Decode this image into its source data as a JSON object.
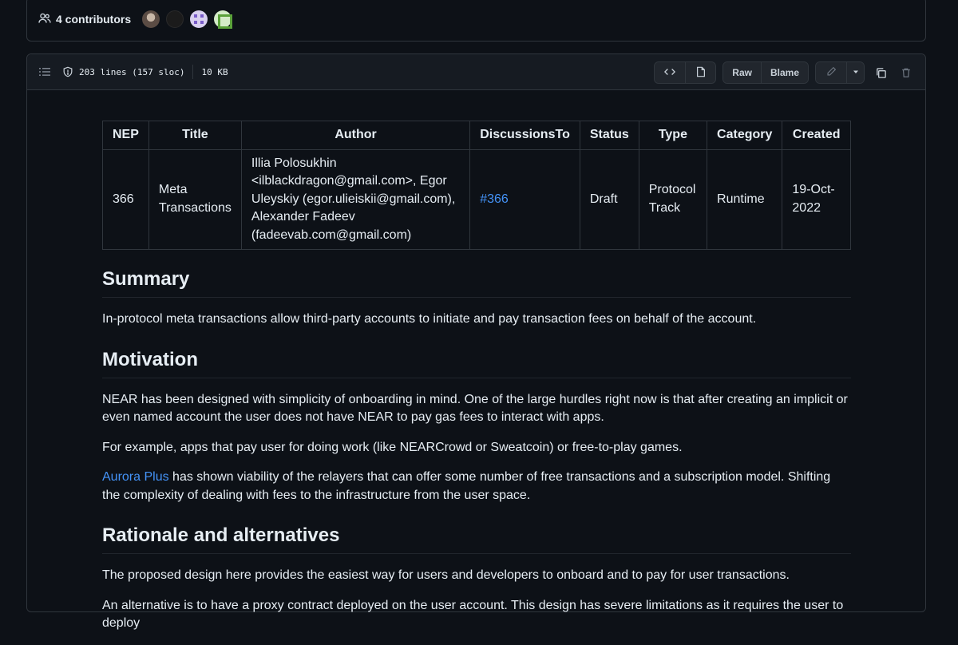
{
  "contributors": {
    "count_label": "4 contributors",
    "avatars": [
      "contributor-1",
      "contributor-2",
      "contributor-3",
      "contributor-4"
    ]
  },
  "file_header": {
    "lines": "203 lines (157 sloc)",
    "size": "10 KB",
    "raw_label": "Raw",
    "blame_label": "Blame"
  },
  "table": {
    "headers": [
      "NEP",
      "Title",
      "Author",
      "DiscussionsTo",
      "Status",
      "Type",
      "Category",
      "Created"
    ],
    "row": {
      "nep": "366",
      "title": "Meta Transactions",
      "author": "Illia Polosukhin <ilblackdragon@gmail.com>, Egor Uleyskiy (egor.ulieiskii@gmail.com), Alexander Fadeev (fadeevab.com@gmail.com)",
      "discussions": "#366",
      "status": "Draft",
      "type": "Protocol Track",
      "category": "Runtime",
      "created": "19-Oct-2022"
    }
  },
  "sections": {
    "summary": {
      "heading": "Summary",
      "p1": "In-protocol meta transactions allow third-party accounts to initiate and pay transaction fees on behalf of the account."
    },
    "motivation": {
      "heading": "Motivation",
      "p1": "NEAR has been designed with simplicity of onboarding in mind. One of the large hurdles right now is that after creating an implicit or even named account the user does not have NEAR to pay gas fees to interact with apps.",
      "p2": "For example, apps that pay user for doing work (like NEARCrowd or Sweatcoin) or free-to-play games.",
      "p3_link": "Aurora Plus",
      "p3_rest": " has shown viability of the relayers that can offer some number of free transactions and a subscription model. Shifting the complexity of dealing with fees to the infrastructure from the user space."
    },
    "rationale": {
      "heading": "Rationale and alternatives",
      "p1": "The proposed design here provides the easiest way for users and developers to onboard and to pay for user transactions.",
      "p2": "An alternative is to have a proxy contract deployed on the user account. This design has severe limitations as it requires the user to deploy"
    }
  },
  "colors": {
    "background": "#0d1117",
    "border": "#30363d",
    "link": "#4493f8",
    "text": "#e6edf3"
  }
}
